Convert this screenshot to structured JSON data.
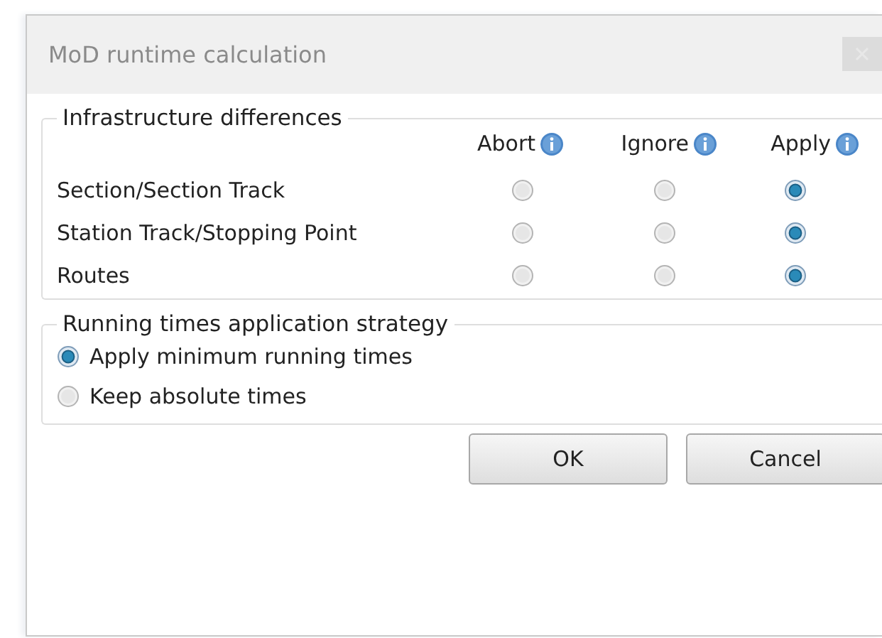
{
  "window": {
    "title": "MoD runtime calculation"
  },
  "infrastructure": {
    "title": "Infrastructure differences",
    "columns": [
      {
        "label": "Abort"
      },
      {
        "label": "Ignore"
      },
      {
        "label": "Apply"
      }
    ],
    "rows": [
      {
        "label": "Section/Section Track",
        "options": [
          {
            "selected": false
          },
          {
            "selected": false
          },
          {
            "selected": true
          }
        ]
      },
      {
        "label": "Station Track/Stopping Point",
        "options": [
          {
            "selected": false
          },
          {
            "selected": false
          },
          {
            "selected": true
          }
        ]
      },
      {
        "label": "Routes",
        "options": [
          {
            "selected": false
          },
          {
            "selected": false
          },
          {
            "selected": true
          }
        ]
      }
    ]
  },
  "strategy": {
    "title": "Running times application strategy",
    "options": [
      {
        "label": "Apply minimum running times",
        "selected": true
      },
      {
        "label": "Keep absolute times",
        "selected": false
      }
    ]
  },
  "buttons": [
    {
      "label": "OK"
    },
    {
      "label": "Cancel"
    }
  ]
}
